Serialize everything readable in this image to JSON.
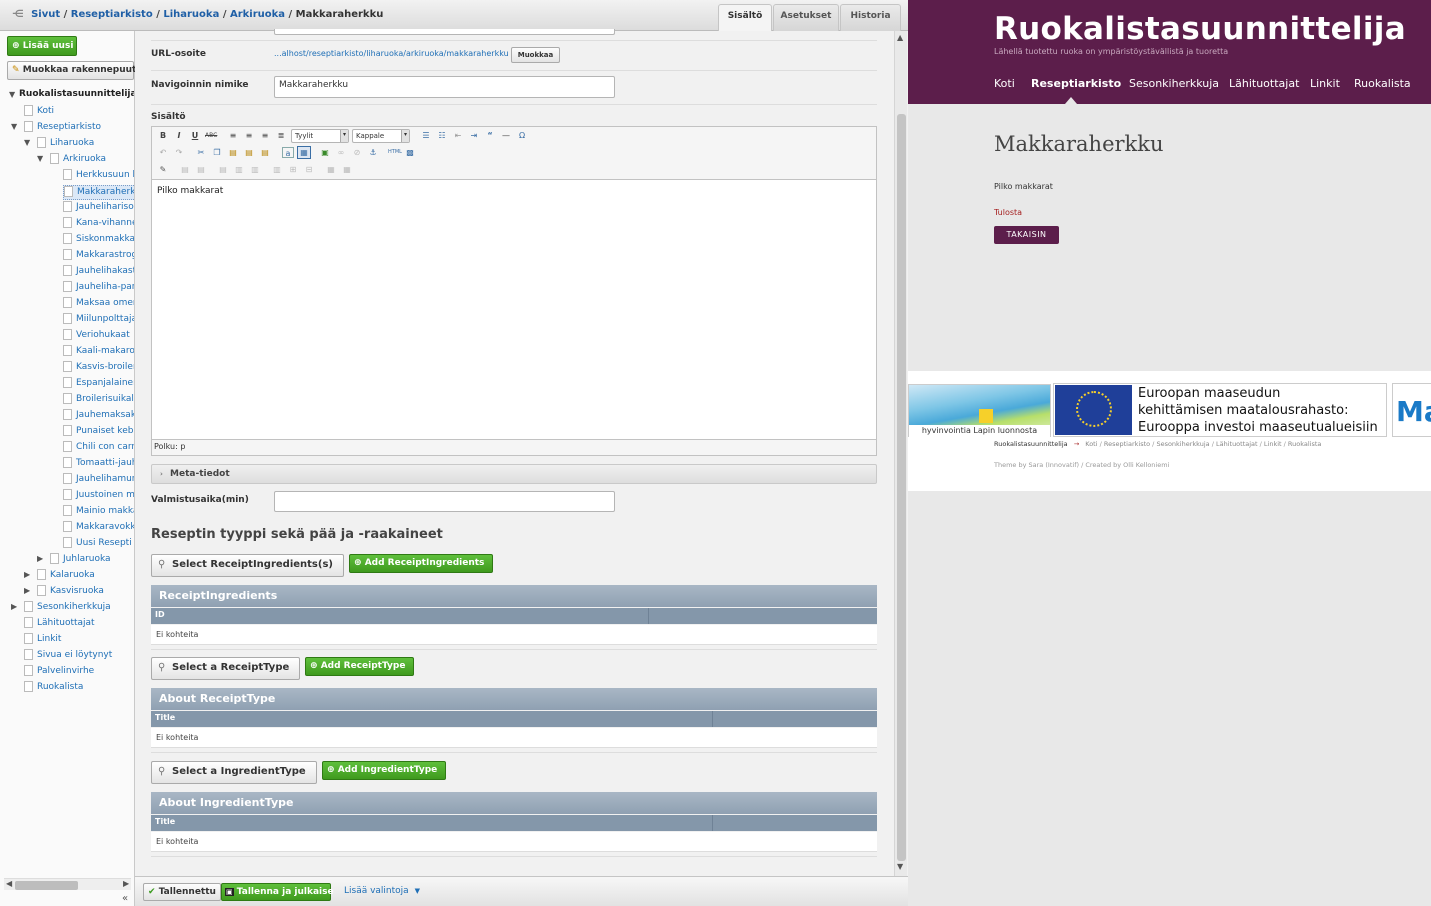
{
  "breadcrumb": {
    "items": [
      "Sivut",
      "Reseptiarkisto",
      "Liharuoka",
      "Arkiruoka"
    ],
    "current": "Makkaraherkku",
    "separator": "/"
  },
  "tabs": [
    {
      "label": "Sisältö"
    },
    {
      "label": "Asetukset"
    },
    {
      "label": "Historia"
    }
  ],
  "left_panel": {
    "add_new": "Lisää uusi",
    "edit_tree": "Muokkaa rakennepuuta",
    "tree_root": "Ruokalistasuunnittelija",
    "tree": [
      "Koti",
      "Reseptiarkisto",
      "Liharuoka",
      "Arkiruoka",
      "Herkkusuun br",
      "Makkaraherkk",
      "Jauheliharisott",
      "Kana-vihannes",
      "Siskonmakkar",
      "Makkarastroga",
      "Jauhelihakastil",
      "Jauheliha-pars",
      "Maksaa omena",
      "Miilunpolttajan",
      "Veriohukaat",
      "Kaali-makaron",
      "Kasvis-broileri",
      "Espanjalainen",
      "Broilerisuikale",
      "Jauhemaksaka",
      "Punaiset keba",
      "Chili con carne",
      "Tomaatti-jauh",
      "Jauhelihamure",
      "Juustoinen me",
      "Mainio makka",
      "Makkaravokki",
      "Uusi Resepti S",
      "Juhlaruoka",
      "Kalaruoka",
      "Kasvisruoka",
      "Sesonkiherkkuja",
      "Lähituottajat",
      "Linkit",
      "Sivua ei löytynyt",
      "Palvelinvirhe",
      "Ruokalista"
    ]
  },
  "form": {
    "url_label": "URL-osoite",
    "url_value": "...alhost/reseptiarkisto/liharuoka/arkiruoka/makkaraherkku",
    "url_edit": "Muokkaa",
    "nav_label": "Navigoinnin nimike",
    "nav_value": "Makkaraherkku",
    "content_label": "Sisältö",
    "styles_select": "Tyylit",
    "format_select": "Kappale",
    "content_text": "Pilko makkarat",
    "path_label": "Polku: p",
    "meta_label": "Meta-tiedot",
    "prep_label": "Valmistusaika(min)",
    "prep_value": "",
    "section_title": "Reseptin tyyppi sekä pää ja -raakaineet",
    "empty_text": "Ei kohteita"
  },
  "relations": [
    {
      "select": "Select ReceiptIngredients(s)",
      "add": "Add ReceiptIngredients",
      "title": "ReceiptIngredients",
      "column": "ID"
    },
    {
      "select": "Select a ReceiptType",
      "add": "Add ReceiptType",
      "title": "About ReceiptType",
      "column": "Title"
    },
    {
      "select": "Select a IngredientType",
      "add": "Add IngredientType",
      "title": "About IngredientType",
      "column": "Title"
    }
  ],
  "bottom": {
    "saved": "Tallennettu",
    "publish": "Tallenna ja julkaise",
    "more": "Lisää valintoja"
  },
  "preview": {
    "site_title": "Ruokalistasuunnittelija",
    "tagline": "Lähellä tuotettu ruoka on ympäristöystävällistä ja tuoretta",
    "nav": [
      "Koti",
      "Reseptiarkisto",
      "Sesonkiherkkuja",
      "Lähituottajat",
      "Linkit",
      "Ruokalista"
    ],
    "page_title": "Makkaraherkku",
    "body_text": "Pilko makkarat",
    "print_link": "Tulosta",
    "back_button": "TAKAISIN",
    "banner_caption": "hyvinvointia Lapin luonnosta",
    "eu_text": [
      "Euroopan maaseudun",
      "kehittämisen maatalousrahasto:",
      "Eurooppa investoi maaseutualueisiin"
    ],
    "banner_cut": "Ma",
    "footer_crumb_root": "Ruokalistasuunnittelija",
    "footer_links": [
      "Koti",
      "Reseptiarkisto",
      "Sesonkiherkkuja",
      "Lähituottajat",
      "Linkit",
      "Ruokalista"
    ],
    "credits": "Theme by Sara (Innovatif) / Created by Olli Kelloniemi"
  },
  "colors": {
    "brand": "#5c1e4b",
    "link": "#1f6fb6",
    "green": "#4aa52a"
  }
}
